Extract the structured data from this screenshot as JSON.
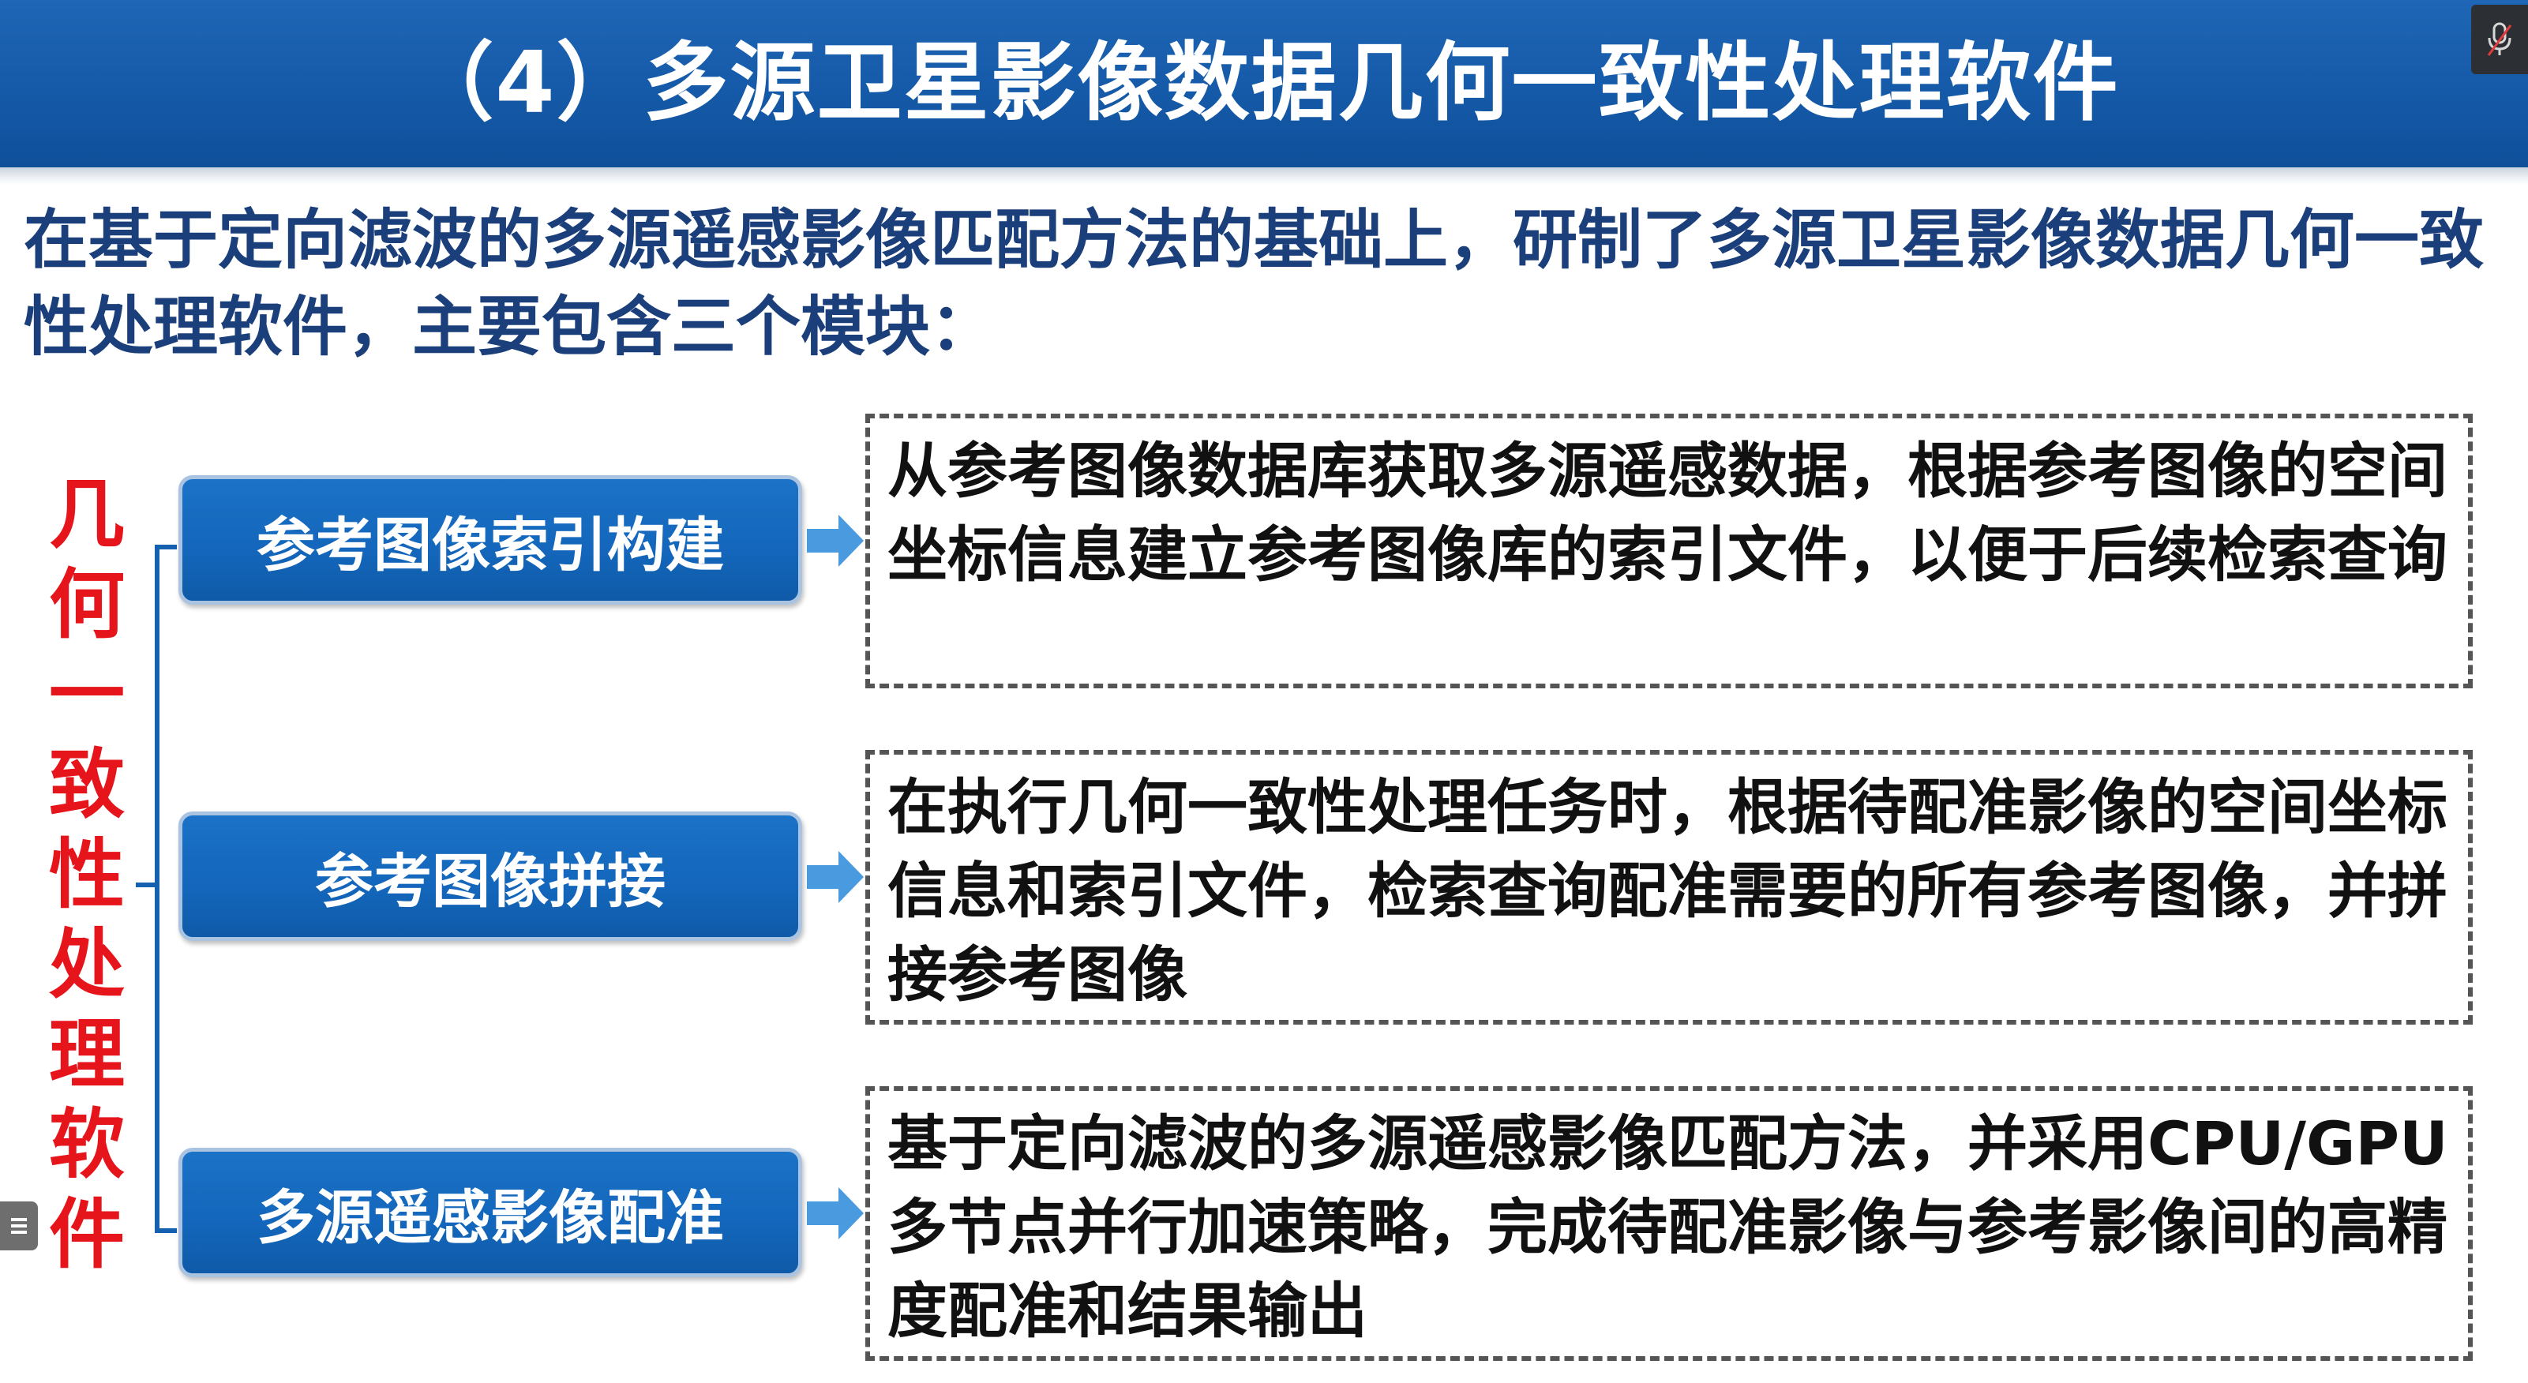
{
  "header": {
    "title": "（4）多源卫星影像数据几何一致性处理软件"
  },
  "intro": {
    "text": "在基于定向滤波的多源遥感影像匹配方法的基础上，研制了多源卫星影像数据几何一致性处理软件，主要包含三个模块："
  },
  "vertical_label": [
    "几",
    "何",
    "一",
    "致",
    "性",
    "处",
    "理",
    "软",
    "件"
  ],
  "modules": [
    {
      "label": "参考图像索引构建",
      "description": "从参考图像数据库获取多源遥感数据，根据参考图像的空间坐标信息建立参考图像库的索引文件，以便于后续检索查询"
    },
    {
      "label": "参考图像拼接",
      "description": "在执行几何一致性处理任务时，根据待配准影像的空间坐标信息和索引文件，检索查询配准需要的所有参考图像，并拼接参考图像"
    },
    {
      "label": "多源遥感影像配准",
      "description": "基于定向滤波的多源遥感影像匹配方法，并采用CPU/GPU多节点并行加速策略，完成待配准影像与参考影像间的高精度配准和结果输出"
    }
  ],
  "colors": {
    "header_blue": "#155aa8",
    "intro_text": "#1b3f7a",
    "vertical_label_red": "#e6141b",
    "module_button_blue": "#1366bb",
    "arrow_blue": "#4a9ae0"
  },
  "icons": {
    "mic": "mic-muted-icon",
    "side_handle": "menu-lines-icon"
  }
}
